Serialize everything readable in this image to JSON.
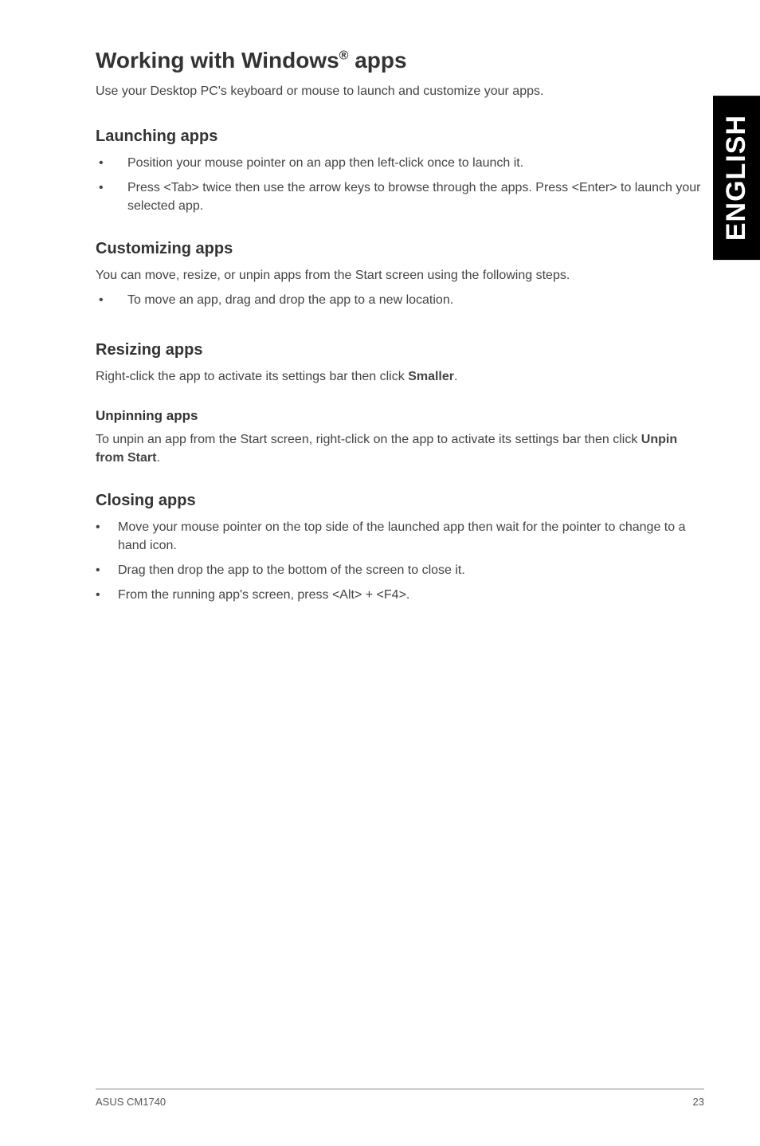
{
  "sideTab": "ENGLISH",
  "heading": {
    "pre": "Working with Windows",
    "sup": "®",
    "post": " apps"
  },
  "intro": "Use your Desktop PC's keyboard or mouse to launch and customize your apps.",
  "sections": {
    "launching": {
      "title": "Launching apps",
      "items": [
        "Position your mouse pointer on an app then left-click once to launch it.",
        "Press <Tab> twice then use the arrow keys to browse through the apps. Press <Enter> to launch your selected app."
      ]
    },
    "customizing": {
      "title": "Customizing apps",
      "para": "You can move, resize, or unpin apps from the Start screen using the following steps.",
      "items": [
        "To move an app, drag and drop the app to a new location."
      ]
    },
    "resizing": {
      "title": "Resizing apps",
      "para_pre": "Right-click the app to activate its settings bar then click ",
      "para_bold": "Smaller",
      "para_post": "."
    },
    "unpinning": {
      "title": "Unpinning apps",
      "para_pre": "To unpin an app from the Start screen, right-click on the app to activate its settings bar then click ",
      "para_bold": "Unpin from Start",
      "para_post": "."
    },
    "closing": {
      "title": "Closing apps",
      "items": [
        "Move your mouse pointer on the top side of the launched app then wait for the pointer to change to a hand icon.",
        "Drag then drop the app to the bottom of the screen to close it.",
        "From the running app's screen, press <Alt> + <F4>."
      ]
    }
  },
  "footer": {
    "left": "ASUS CM1740",
    "right": "23"
  }
}
